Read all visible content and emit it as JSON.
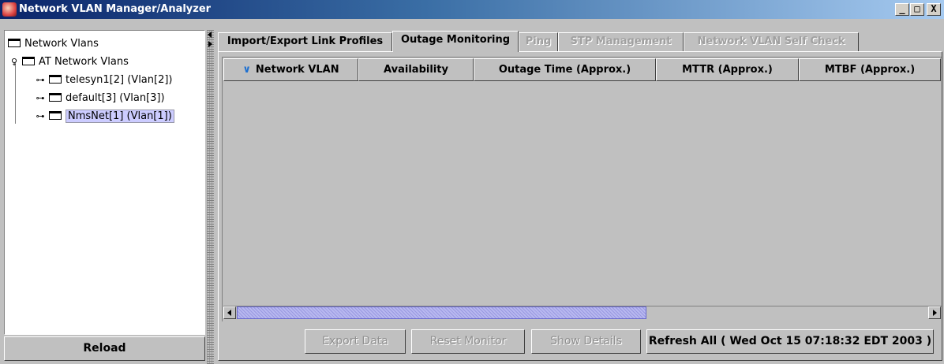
{
  "window": {
    "title": "Network VLAN Manager/Analyzer",
    "icon": "app-icon",
    "controls": {
      "minimize": "_",
      "maximize": "□",
      "close": "X"
    }
  },
  "tree": {
    "root": "Network Vlans",
    "group": "AT Network Vlans",
    "items": [
      {
        "label": "telesyn1[2] (Vlan[2])",
        "selected": false
      },
      {
        "label": "default[3] (Vlan[3])",
        "selected": false
      },
      {
        "label": "NmsNet[1] (Vlan[1])",
        "selected": true
      }
    ],
    "icons": {
      "collapsed": "key-handle-icon",
      "expanded": "pin-handle-icon",
      "folder": "folder-icon"
    }
  },
  "reload_label": "Reload",
  "tabs": [
    {
      "label": "Import/Export Link Profiles",
      "state": "normal"
    },
    {
      "label": "Outage Monitoring",
      "state": "active"
    },
    {
      "label": "Ping",
      "state": "disabled"
    },
    {
      "label": "STP Management",
      "state": "disabled"
    },
    {
      "label": "Network VLAN Self Check",
      "state": "disabled"
    }
  ],
  "table": {
    "columns": [
      "Network VLAN",
      "Availability",
      "Outage Time (Approx.)",
      "MTTR (Approx.)",
      "MTBF (Approx.)"
    ],
    "sorted_column": "Network VLAN",
    "sort_icon": "chevron-down-icon",
    "rows": []
  },
  "buttons": {
    "export": "Export Data",
    "reset": "Reset Monitor",
    "details": "Show Details",
    "refresh": "Refresh All ( Wed Oct 15 07:18:32 EDT 2003 )"
  },
  "colors": {
    "accent": "#1e70d0",
    "selection": "#ccccff",
    "titlebar_start": "#0a246a",
    "titlebar_end": "#a6caf0"
  }
}
